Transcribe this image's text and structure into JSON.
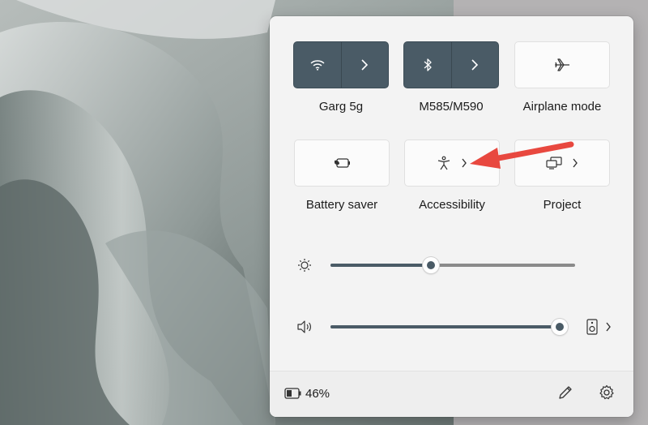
{
  "quick_settings": {
    "tiles": [
      {
        "label": "Garg 5g",
        "icon": "wifi-icon",
        "state": "on"
      },
      {
        "label": "M585/M590",
        "icon": "bluetooth-icon",
        "state": "on"
      },
      {
        "label": "Airplane mode",
        "icon": "airplane-icon",
        "state": "off"
      },
      {
        "label": "Battery saver",
        "icon": "battery-saver-icon",
        "state": "off"
      },
      {
        "label": "Accessibility",
        "icon": "accessibility-icon",
        "state": "off"
      },
      {
        "label": "Project",
        "icon": "project-icon",
        "state": "off"
      }
    ],
    "brightness": {
      "icon": "brightness-icon",
      "value": 0.41
    },
    "volume": {
      "icon": "speaker-icon",
      "value": 0.97,
      "output_icon": "audio-output-icon"
    },
    "battery": {
      "icon": "battery-icon",
      "percent_text": "46%"
    },
    "footer_icons": [
      "edit-icon",
      "settings-icon"
    ]
  },
  "colors": {
    "accent": "#4a5b66",
    "panel": "#f3f3f3",
    "annotation_arrow": "#e8483f"
  }
}
